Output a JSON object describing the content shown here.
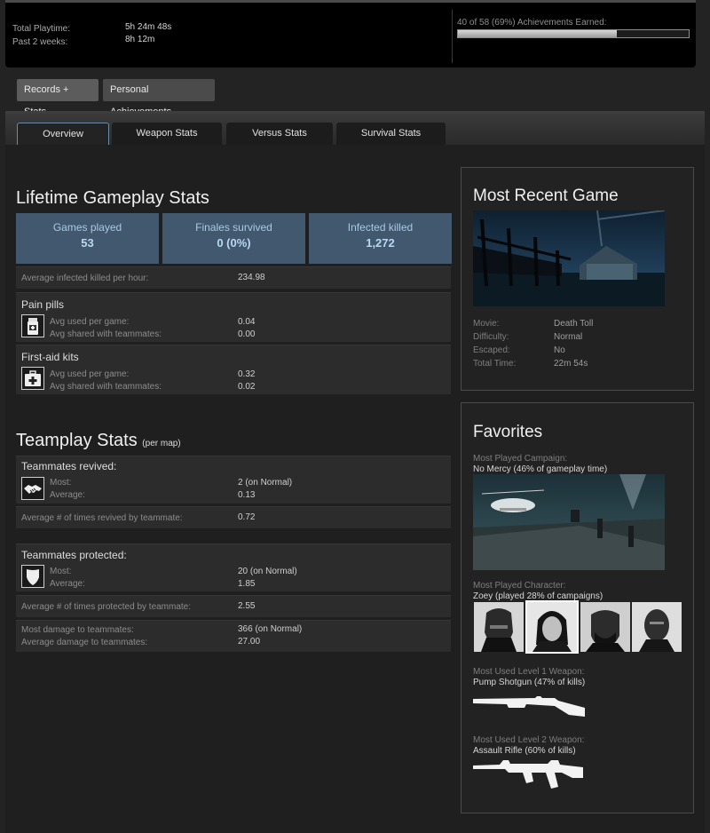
{
  "summary": {
    "total_playtime_label": "Total Playtime:",
    "total_playtime_value": "5h 24m 48s",
    "past_two_weeks_label": "Past 2 weeks:",
    "past_two_weeks_value": "8h 12m",
    "achievements_text": "40 of 58 (69%) Achievements Earned:",
    "achievements_progress": 0.69
  },
  "subnav": {
    "records_stats": "Records + Stats",
    "personal_achievements": "Personal Achievements"
  },
  "tabs": {
    "overview": "Overview",
    "weapon_stats": "Weapon Stats",
    "versus_stats": "Versus Stats",
    "survival_stats": "Survival Stats"
  },
  "lifetime": {
    "title": "Lifetime Gameplay Stats",
    "games_played_label": "Games played",
    "games_played_value": "53",
    "finales_survived_label": "Finales survived",
    "finales_survived_value": "0 (0%)",
    "infected_killed_label": "Infected killed",
    "infected_killed_value": "1,272",
    "avg_infected_label": "Average infected killed per hour:",
    "avg_infected_value": "234.98",
    "pain_pills_title": "Pain pills",
    "pills_used_label": "Avg used per game:",
    "pills_used_value": "0.04",
    "pills_shared_label": "Avg shared with teammates:",
    "pills_shared_value": "0.00",
    "first_aid_title": "First-aid kits",
    "kits_used_label": "Avg used per game:",
    "kits_used_value": "0.32",
    "kits_shared_label": "Avg shared with teammates:",
    "kits_shared_value": "0.02"
  },
  "teamplay": {
    "title": "Teamplay Stats",
    "subtitle": "(per map)",
    "revived_title": "Teammates revived:",
    "revived_most_label": "Most:",
    "revived_most_value": "2 (on Normal)",
    "revived_avg_label": "Average:",
    "revived_avg_value": "0.13",
    "revived_by_label": "Average # of times revived by teammate:",
    "revived_by_value": "0.72",
    "protected_title": "Teammates protected:",
    "protected_most_label": "Most:",
    "protected_most_value": "20 (on Normal)",
    "protected_avg_label": "Average:",
    "protected_avg_value": "1.85",
    "protected_by_label": "Average # of times protected by teammate:",
    "protected_by_value": "2.55",
    "most_damage_label": "Most damage to teammates:",
    "most_damage_value": "366 (on Normal)",
    "avg_damage_label": "Average damage to teammates:",
    "avg_damage_value": "27.00"
  },
  "recent_game": {
    "title": "Most Recent Game",
    "movie_label": "Movie:",
    "movie_value": "Death Toll",
    "difficulty_label": "Difficulty:",
    "difficulty_value": "Normal",
    "escaped_label": "Escaped:",
    "escaped_value": "No",
    "total_time_label": "Total Time:",
    "total_time_value": "22m 54s"
  },
  "favorites": {
    "title": "Favorites",
    "campaign_label": "Most Played Campaign:",
    "campaign_value": "No Mercy (46% of gameplay time)",
    "character_label": "Most Played Character:",
    "character_value": "Zoey (played 28% of campaigns)",
    "weapon1_label": "Most Used Level 1 Weapon:",
    "weapon1_value": "Pump Shotgun (47% of kills)",
    "weapon2_label": "Most Used Level 2 Weapon:",
    "weapon2_value": "Assault Rifle (60% of kills)"
  },
  "colors": {
    "accent_box": "#41586f",
    "accent_text": "#a9c9e4",
    "background": "#232323"
  }
}
